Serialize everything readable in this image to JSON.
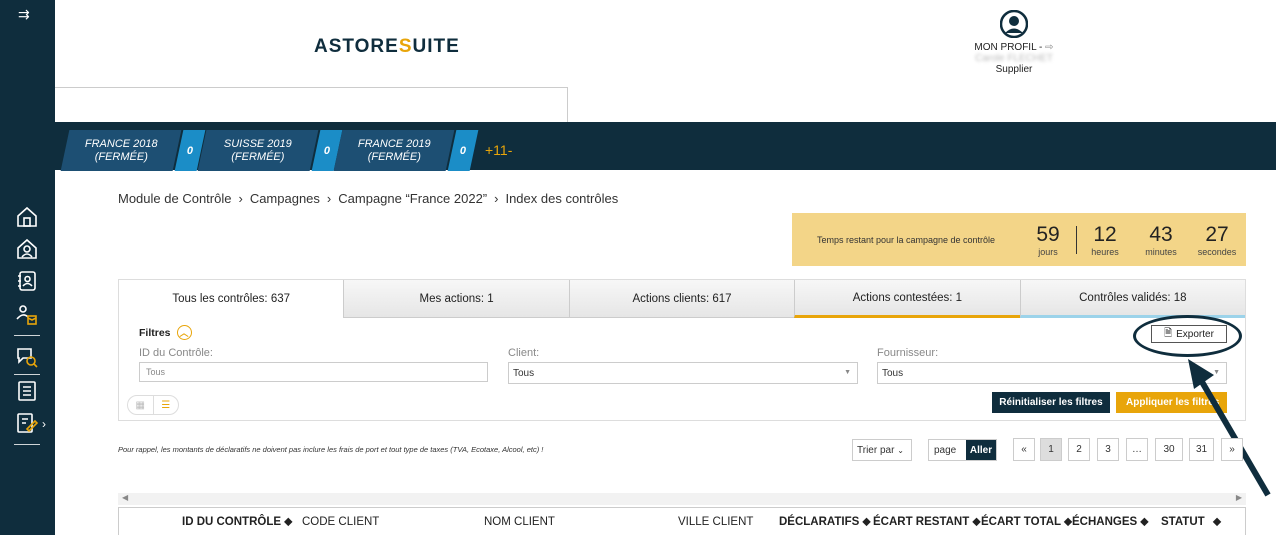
{
  "sidebar": {
    "toggle": "⇉",
    "items": [
      "home-icon",
      "user-home-icon",
      "contacts-icon",
      "user-box-icon",
      "search-chat-icon",
      "list-icon",
      "edit-doc-icon"
    ],
    "chevron": "›"
  },
  "header": {
    "logo_a": "ASTORE",
    "logo_s": "S",
    "logo_b": "UITE",
    "profile_label": "MON PROFIL -",
    "profile_name": "Carole FLECHET",
    "profile_role": "Supplier"
  },
  "campaigns": [
    {
      "l1": "FRANCE 2018",
      "l2": "(FERMÉE)",
      "count": "0"
    },
    {
      "l1": "SUISSE 2019",
      "l2": "(FERMÉE)",
      "count": "0"
    },
    {
      "l1": "FRANCE 2019",
      "l2": "(FERMÉE)",
      "count": "0"
    }
  ],
  "campaigns_more": "+11-",
  "breadcrumb": [
    "Module de Contrôle",
    "Campagnes",
    "Campagne “France 2022”",
    "Index des contrôles"
  ],
  "timer": {
    "label": "Temps restant pour la campagne de contrôle",
    "days": "59",
    "days_u": "jours",
    "hours": "12",
    "hours_u": "heures",
    "minutes": "43",
    "minutes_u": "minutes",
    "seconds": "27",
    "seconds_u": "secondes"
  },
  "tabs": [
    "Tous les contrôles: 637",
    "Mes actions: 1",
    "Actions clients: 617",
    "Actions contestées: 1",
    "Contrôles validés: 18"
  ],
  "filters": {
    "title": "Filtres",
    "export": "Exporter",
    "id_label": "ID du Contrôle:",
    "id_placeholder": "Tous",
    "client_label": "Client:",
    "client_value": "Tous",
    "supplier_label": "Fournisseur:",
    "supplier_value": "Tous",
    "reset": "Réinitialiser les filtres",
    "apply": "Appliquer les filtres"
  },
  "note": "Pour rappel, les montants de déclaratifs ne doivent pas inclure les frais de port et tout type de taxes (TVA, Ecotaxe, Alcool, etc) !",
  "sort_label": "Trier par",
  "page_label": "page",
  "go_label": "Aller",
  "pagination": [
    "«",
    "1",
    "2",
    "3",
    "…",
    "30",
    "31",
    "»"
  ],
  "columns": [
    "ID DU CONTRÔLE ⬥",
    "CODE CLIENT",
    "NOM CLIENT",
    "VILLE CLIENT",
    "DÉCLARATIFS ⬥",
    "ÉCART RESTANT ⬥",
    "ÉCART TOTAL ⬥",
    "ÉCHANGES ⬥",
    "STATUT",
    "⬥"
  ],
  "colors": {
    "navy": "#0f2d3d",
    "accent": "#e8a50a",
    "campaign": "#1d4f73",
    "count": "#1b8dc7"
  }
}
